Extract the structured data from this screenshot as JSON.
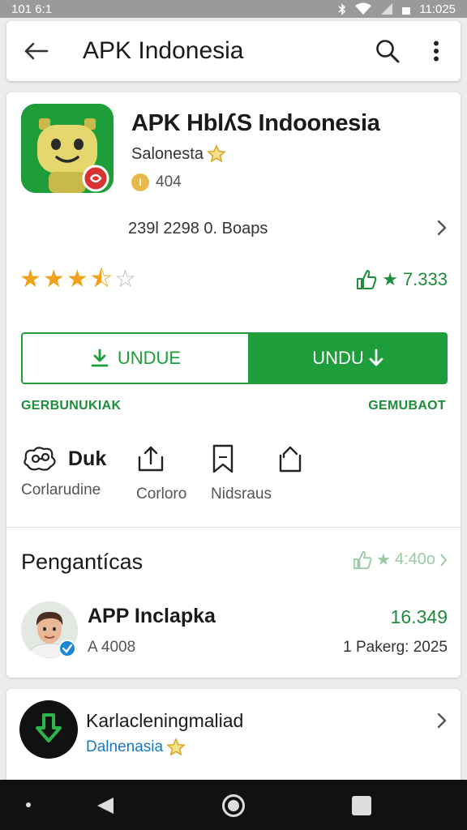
{
  "status_bar": {
    "time_left": "101 6:1",
    "time_right": "11:025"
  },
  "app_bar": {
    "title": "APK Indonesia"
  },
  "app": {
    "name": "APK HblʎS Indoonesia",
    "developer": "Salonesta",
    "coin_label": "I",
    "meta": "404",
    "stats": "239l 2298 0. Boaps",
    "stars": {
      "filled": 3,
      "half": 1,
      "empty": 1
    },
    "rating": "7.333"
  },
  "buttons": {
    "outline_label": "UNDUE",
    "fill_label": "UNDU"
  },
  "sublinks": {
    "left": "GERBUNUKIAK",
    "right": "GEMUBAOT"
  },
  "actions": [
    {
      "label": "Corlarudine",
      "title": "Duk"
    },
    {
      "label": "Corloro"
    },
    {
      "label": "Nidsraus"
    }
  ],
  "reviews": {
    "title": "Pengantícas",
    "rating": "4:40o",
    "item": {
      "title": "APP Inclapka",
      "sub": "A 4008",
      "number": "16.349",
      "date": "1   Pakerg: 2025"
    }
  },
  "promo": {
    "title": "Karlacleningmaliad",
    "sub": "Dalnenasia"
  },
  "colors": {
    "accent": "#1e9e3a",
    "star": "#f0a31a",
    "link": "#1a78c8"
  }
}
